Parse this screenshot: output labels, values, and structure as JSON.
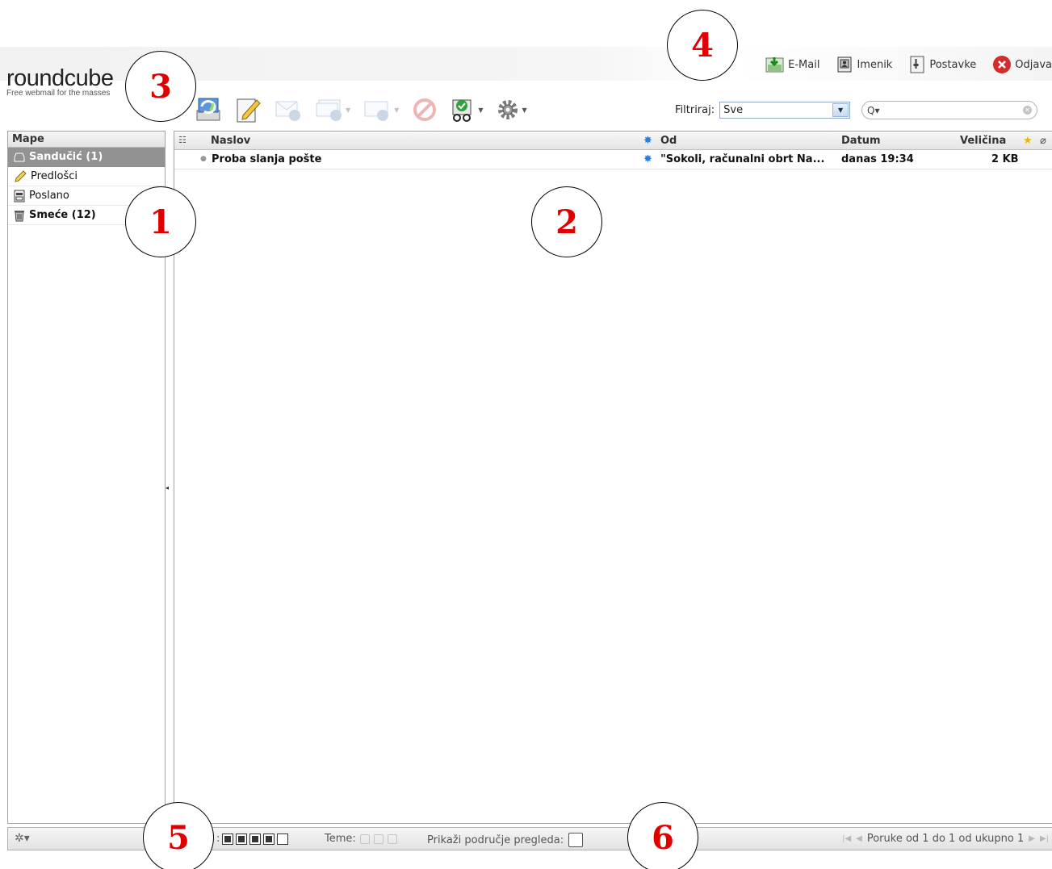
{
  "logo": {
    "name": "roundcube",
    "tagline": "Free webmail for the masses"
  },
  "topnav": {
    "items": [
      {
        "label": "E-Mail",
        "icon": "mail-download-icon"
      },
      {
        "label": "Imenik",
        "icon": "address-book-icon"
      },
      {
        "label": "Postavke",
        "icon": "settings-doc-icon"
      },
      {
        "label": "Odjava",
        "icon": "logout-icon"
      }
    ]
  },
  "toolbar": {
    "buttons": [
      {
        "icon": "check-mail-icon",
        "enabled": true
      },
      {
        "icon": "compose-icon",
        "enabled": true
      },
      {
        "icon": "reply-icon",
        "enabled": false
      },
      {
        "icon": "reply-all-icon",
        "enabled": false,
        "menu": true
      },
      {
        "icon": "forward-icon",
        "enabled": false,
        "menu": true
      },
      {
        "icon": "delete-icon",
        "enabled": false
      },
      {
        "icon": "mark-icon",
        "enabled": true,
        "menu": true
      },
      {
        "icon": "more-actions-icon",
        "enabled": true,
        "menu": true
      }
    ]
  },
  "filter": {
    "label": "Filtriraj:",
    "value": "Sve"
  },
  "search": {
    "placeholder": ""
  },
  "folders": {
    "header": "Mape",
    "items": [
      {
        "label": "Sandučić (1)",
        "icon": "inbox-icon",
        "selected": true,
        "unread": true
      },
      {
        "label": "Predlošci",
        "icon": "pencil-icon",
        "selected": false,
        "unread": false
      },
      {
        "label": "Poslano",
        "icon": "sent-icon",
        "selected": false,
        "unread": false
      },
      {
        "label": "Smeće (12)",
        "icon": "trash-icon",
        "selected": false,
        "unread": true
      }
    ]
  },
  "messages": {
    "columns": {
      "subject": "Naslov",
      "from": "Od",
      "date": "Datum",
      "size": "Veličina"
    },
    "rows": [
      {
        "subject": "Proba slanja pošte",
        "from": "\"Sokoli, računalni obrt Na...",
        "date": "danas 19:34",
        "size": "2 KB"
      }
    ]
  },
  "footer": {
    "layout_label": ":",
    "themes_label": "Teme:",
    "preview_label": "Prikaži područje pregleda:",
    "pager_text": "Poruke od 1 do 1 od ukupno 1"
  },
  "callouts": [
    "1",
    "2",
    "3",
    "4",
    "5",
    "6"
  ],
  "colors": {
    "selected_folder": "#929292",
    "callout_number": "#e00000",
    "accent": "#8fa9c9"
  }
}
